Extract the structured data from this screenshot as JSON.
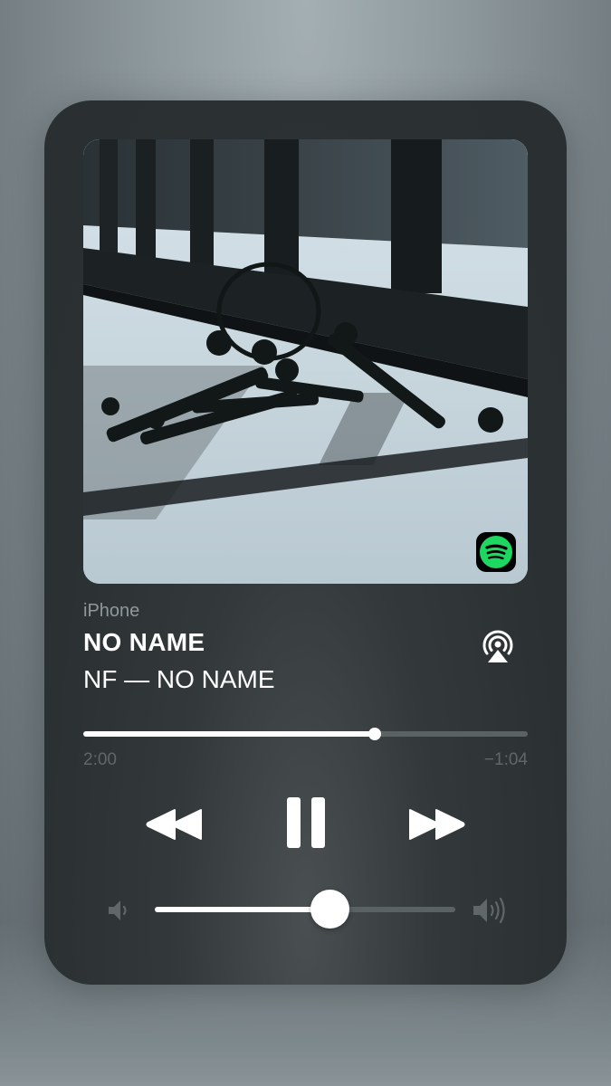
{
  "now_playing": {
    "source": "iPhone",
    "title": "NO NAME",
    "subtitle": "NF — NO NAME",
    "artwork_badge_icon": "spotify-icon",
    "output_icon": "airplay-icon"
  },
  "playback": {
    "elapsed": "2:00",
    "remaining": "−1:04",
    "progress_fraction": 0.656,
    "state": "playing"
  },
  "controls": {
    "previous_icon": "rewind-icon",
    "play_pause_icon": "pause-icon",
    "next_icon": "fast-forward-icon"
  },
  "volume": {
    "level_fraction": 0.58,
    "low_icon": "volume-low-icon",
    "high_icon": "volume-high-icon"
  },
  "colors": {
    "spotify_green": "#1ed760",
    "foreground": "#ffffff"
  }
}
